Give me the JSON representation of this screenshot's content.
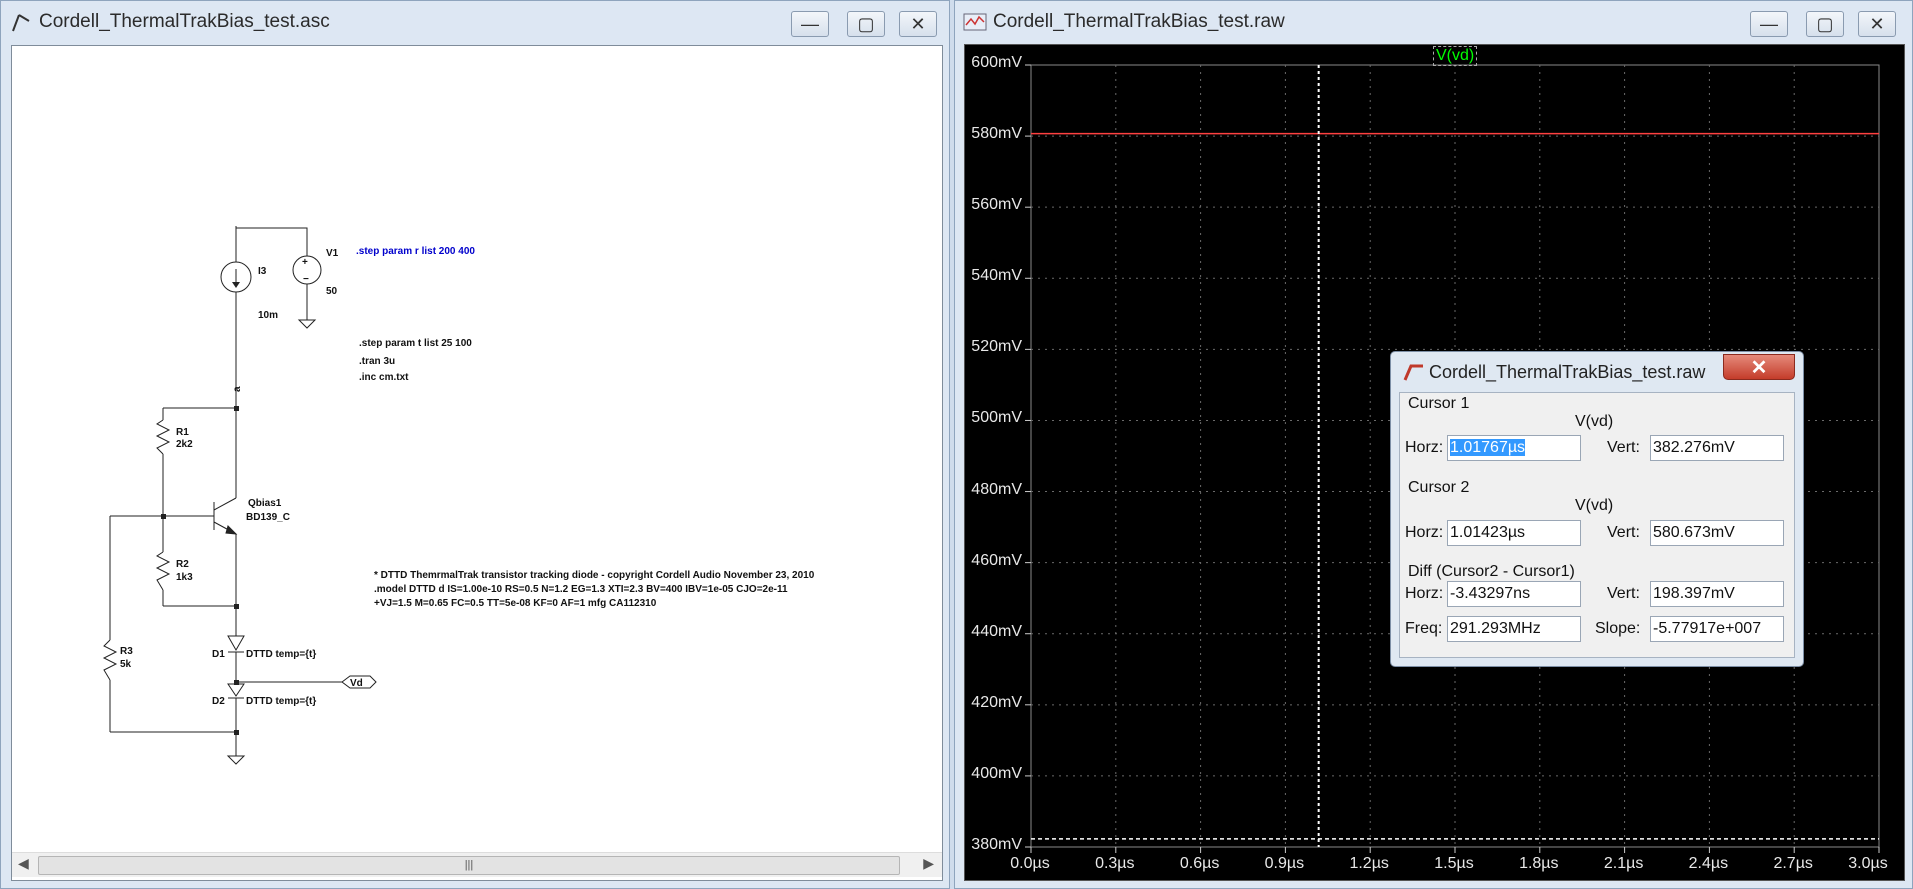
{
  "schematic_window": {
    "title": "Cordell_ThermalTrakBias_test.asc",
    "components": {
      "V1": {
        "name": "V1",
        "value": "50"
      },
      "I3": {
        "name": "I3",
        "value": "10m"
      },
      "R1": {
        "name": "R1",
        "value": "2k2"
      },
      "R2": {
        "name": "R2",
        "value": "1k3"
      },
      "R3": {
        "name": "R3",
        "value": "5k"
      },
      "Q": {
        "name": "Qbias1",
        "value": "BD139_C"
      },
      "D1": {
        "name": "D1",
        "value": "DTTD temp={t}"
      },
      "D2": {
        "name": "D2",
        "value": "DTTD temp={t}"
      },
      "net_a": "a",
      "vd_label": "Vd"
    },
    "directives": {
      "step_r": ".step param r list  200 400",
      "step_t": ".step param t list 25 100",
      "tran": ".tran 3u",
      "inc": ".inc cm.txt",
      "comment": "* DTTD  ThemrmalTrak transistor tracking diode - copyright Cordell Audio November 23, 2010",
      "model1": ".model DTTD d IS=1.00e-10 RS=0.5 N=1.2 EG=1.3 XTI=2.3 BV=400 IBV=1e-05 CJO=2e-11",
      "model2": "+VJ=1.5 M=0.65 FC=0.5 TT=5e-08 KF=0 AF=1 mfg CA112310"
    },
    "scroll_thumb": "|||"
  },
  "waveform_window": {
    "title": "Cordell_ThermalTrakBias_test.raw",
    "trace_label": "V(vd)",
    "trace_color": "#00ff00",
    "background": "#000000"
  },
  "chart_data": {
    "type": "line",
    "series": [
      {
        "name": "V(vd)",
        "x": [
          0.0,
          3.0
        ],
        "y": [
          580.7,
          580.7
        ],
        "color": "#ff4040"
      },
      {
        "name": "V(vd)",
        "x": [
          0.0,
          3.0
        ],
        "y": [
          382.3,
          382.3
        ],
        "color": "#ffffff"
      }
    ],
    "y_ticks": [
      "600mV",
      "580mV",
      "560mV",
      "540mV",
      "520mV",
      "500mV",
      "480mV",
      "460mV",
      "440mV",
      "420mV",
      "400mV",
      "380mV"
    ],
    "x_ticks": [
      "0.0µs",
      "0.3µs",
      "0.6µs",
      "0.9µs",
      "1.2µs",
      "1.5µs",
      "1.8µs",
      "2.1µs",
      "2.4µs",
      "2.7µs",
      "3.0µs"
    ],
    "xlim": [
      0.0,
      3.0
    ],
    "ylim": [
      380,
      600
    ],
    "grid": true,
    "cursor_x": 1.01767
  },
  "cursor_dialog": {
    "title": "Cordell_ThermalTrakBias_test.raw",
    "close": "✕",
    "cursor1": {
      "heading": "Cursor 1",
      "trace": "V(vd)",
      "horz_label": "Horz:",
      "horz": "1.01767µs",
      "vert_label": "Vert:",
      "vert": "382.276mV"
    },
    "cursor2": {
      "heading": "Cursor 2",
      "trace": "V(vd)",
      "horz_label": "Horz:",
      "horz": "1.01423µs",
      "vert_label": "Vert:",
      "vert": "580.673mV"
    },
    "diff": {
      "heading": "Diff (Cursor2 - Cursor1)",
      "horz_label": "Horz:",
      "horz": "-3.43297ns",
      "vert_label": "Vert:",
      "vert": "198.397mV",
      "freq_label": "Freq:",
      "freq": "291.293MHz",
      "slope_label": "Slope:",
      "slope": "-5.77917e+007"
    }
  }
}
